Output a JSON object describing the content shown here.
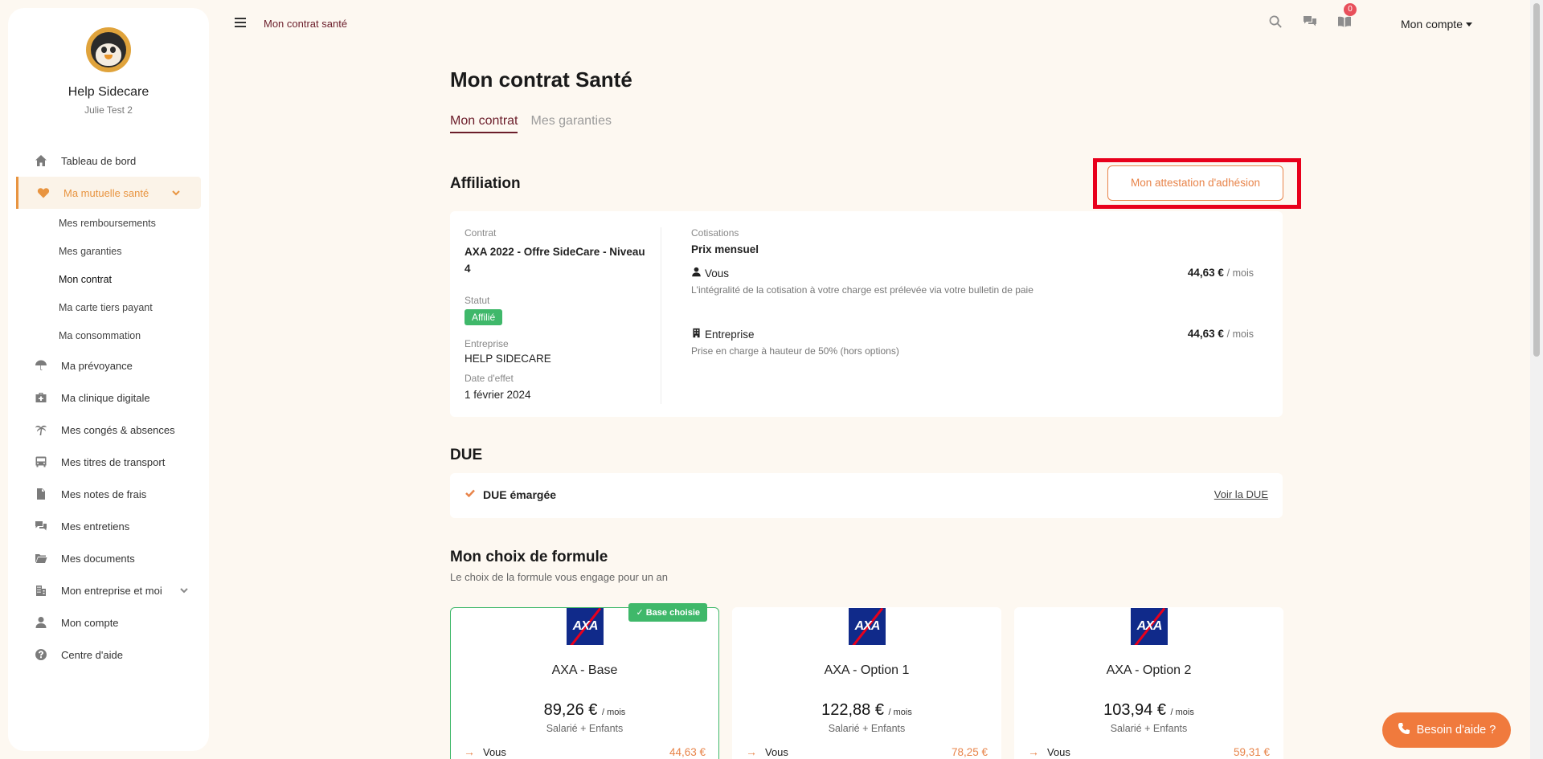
{
  "sidebar": {
    "brand_name": "Help Sidecare",
    "user_name": "Julie Test 2",
    "items": [
      {
        "label": "Tableau de bord",
        "icon": "home-icon"
      },
      {
        "label": "Ma mutuelle santé",
        "icon": "heart-icon",
        "active": true
      },
      {
        "label": "Ma prévoyance",
        "icon": "umbrella-icon"
      },
      {
        "label": "Ma clinique digitale",
        "icon": "medical-kit-icon"
      },
      {
        "label": "Mes congés & absences",
        "icon": "palm-tree-icon"
      },
      {
        "label": "Mes titres de transport",
        "icon": "bus-icon"
      },
      {
        "label": "Mes notes de frais",
        "icon": "file-icon"
      },
      {
        "label": "Mes entretiens",
        "icon": "chat-icon"
      },
      {
        "label": "Mes documents",
        "icon": "folder-icon"
      },
      {
        "label": "Mon entreprise et moi",
        "icon": "building-icon"
      },
      {
        "label": "Mon compte",
        "icon": "user-icon"
      },
      {
        "label": "Centre d'aide",
        "icon": "help-circle-icon"
      }
    ],
    "sub_items": [
      {
        "label": "Mes remboursements"
      },
      {
        "label": "Mes garanties"
      },
      {
        "label": "Mon contrat",
        "current": true
      },
      {
        "label": "Ma carte tiers payant"
      },
      {
        "label": "Ma consommation"
      }
    ]
  },
  "topbar": {
    "breadcrumb": "Mon contrat santé",
    "notification_count": "0",
    "account_label": "Mon compte"
  },
  "page": {
    "title": "Mon contrat Santé",
    "tabs": [
      {
        "label": "Mon contrat",
        "active": true
      },
      {
        "label": "Mes garanties",
        "active": false
      }
    ]
  },
  "affiliation": {
    "section_title": "Affiliation",
    "attestation_button": "Mon attestation d'adhésion",
    "contract_label": "Contrat",
    "contract_value": "AXA 2022 - Offre SideCare - Niveau 4",
    "status_label": "Statut",
    "status_value": "Affilié",
    "company_label": "Entreprise",
    "company_value": "HELP SIDECARE",
    "effective_label": "Date d'effet",
    "effective_value": "1 février 2024",
    "cotisations_label": "Cotisations",
    "price_heading": "Prix mensuel",
    "rows": [
      {
        "who": "Vous",
        "desc": "L'intégralité de la cotisation à votre charge est prélevée via votre bulletin de paie",
        "amount": "44,63 €",
        "unit": "/ mois"
      },
      {
        "who": "Entreprise",
        "desc": "Prise en charge à hauteur de 50% (hors options)",
        "amount": "44,63 €",
        "unit": "/ mois"
      }
    ]
  },
  "due": {
    "section_title": "DUE",
    "status": "DUE émargée",
    "link": "Voir la DUE"
  },
  "formula": {
    "section_title": "Mon choix de formule",
    "subtitle": "Le choix de la formule vous engage pour un an",
    "chosen_badge": "Base choisie",
    "logo_text": "AXA",
    "plans": [
      {
        "name": "AXA - Base",
        "price": "89,26 €",
        "unit": "/ mois",
        "audience": "Salarié + Enfants",
        "you_label": "Vous",
        "you_price": "44,63 €",
        "chosen": true
      },
      {
        "name": "AXA - Option 1",
        "price": "122,88 €",
        "unit": "/ mois",
        "audience": "Salarié + Enfants",
        "you_label": "Vous",
        "you_price": "78,25 €",
        "chosen": false
      },
      {
        "name": "AXA - Option 2",
        "price": "103,94 €",
        "unit": "/ mois",
        "audience": "Salarié + Enfants",
        "you_label": "Vous",
        "you_price": "59,31 €",
        "chosen": false
      }
    ]
  },
  "help_button": "Besoin d'aide ?",
  "colors": {
    "accent": "#e89440",
    "burgundy": "#6b1d2a",
    "success": "#3fb86a",
    "highlight": "#e8001c",
    "help": "#f07a3d"
  }
}
